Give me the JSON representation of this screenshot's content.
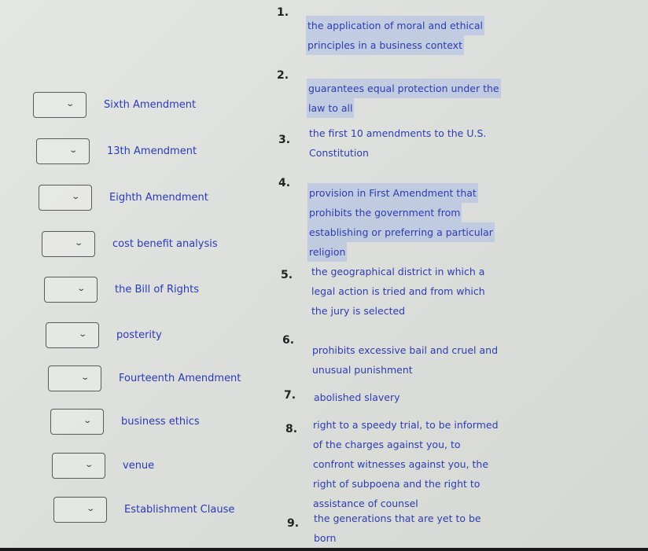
{
  "terms": [
    {
      "label": "Sixth Amendment",
      "selected": ""
    },
    {
      "label": "13th Amendment",
      "selected": ""
    },
    {
      "label": "Eighth Amendment",
      "selected": ""
    },
    {
      "label": "cost benefit analysis",
      "selected": ""
    },
    {
      "label": "the Bill of Rights",
      "selected": ""
    },
    {
      "label": "posterity",
      "selected": ""
    },
    {
      "label": "Fourteenth Amendment",
      "selected": ""
    },
    {
      "label": "business ethics",
      "selected": ""
    },
    {
      "label": "venue",
      "selected": ""
    },
    {
      "label": "Establishment Clause",
      "selected": ""
    }
  ],
  "definitions": [
    {
      "number": "1.",
      "lines": [
        "the application of moral and ethical",
        "principles in a business context"
      ]
    },
    {
      "number": "2.",
      "lines": [
        "guarantees equal protection under the",
        "law to all"
      ]
    },
    {
      "number": "3.",
      "lines": [
        "the first 10 amendments to the U.S.",
        "Constitution"
      ]
    },
    {
      "number": "4.",
      "lines": [
        "provision in First Amendment that",
        "prohibits the government from",
        "establishing or preferring a particular",
        "religion"
      ]
    },
    {
      "number": "5.",
      "lines": [
        "the geographical district in which a",
        "legal action is tried and from which",
        "the jury is selected"
      ]
    },
    {
      "number": "6.",
      "lines": [
        "prohibits excessive bail and cruel and",
        "unusual punishment"
      ]
    },
    {
      "number": "7.",
      "lines": [
        "abolished slavery"
      ]
    },
    {
      "number": "8.",
      "lines": [
        "right to a speedy trial, to be informed",
        "of the charges against you, to",
        "confront witnesses against you, the",
        "right of subpoena and the right to",
        "assistance of counsel"
      ]
    },
    {
      "number": "9.",
      "lines": [
        "the generations that are yet to be",
        "born"
      ]
    }
  ],
  "icons": {
    "dropdown": "chevron-down-icon"
  }
}
